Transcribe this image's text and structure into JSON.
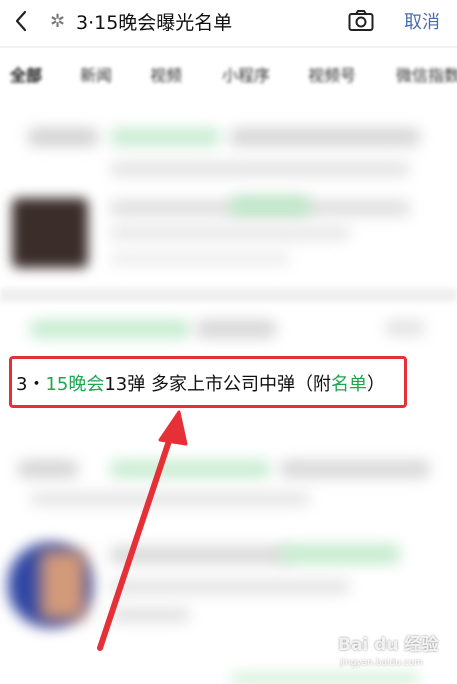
{
  "header": {
    "back_icon": "chevron-left-icon",
    "search_icon": "sparkle-icon",
    "query": "3·15晚会曝光名单",
    "camera_icon": "camera-icon",
    "cancel_label": "取消"
  },
  "tabs": [
    {
      "label": "全部",
      "active": true
    },
    {
      "label": "新闻"
    },
    {
      "label": "视频"
    },
    {
      "label": "小程序"
    },
    {
      "label": "视频号"
    },
    {
      "label": "微信指数"
    }
  ],
  "highlighted_result": {
    "prefix": "3・",
    "highlight1": "15晚会",
    "middle": "13弹 多家上市公司中弹（附",
    "highlight2": "名单",
    "suffix": "）"
  },
  "annotation": {
    "box_color": "#e53037",
    "arrow_color": "#e53037"
  },
  "watermark": {
    "text": "Bai du 经验",
    "sub": "jingyan.baidu.com"
  },
  "colors": {
    "highlight": "#1ea650",
    "link": "#4b6ea8"
  }
}
